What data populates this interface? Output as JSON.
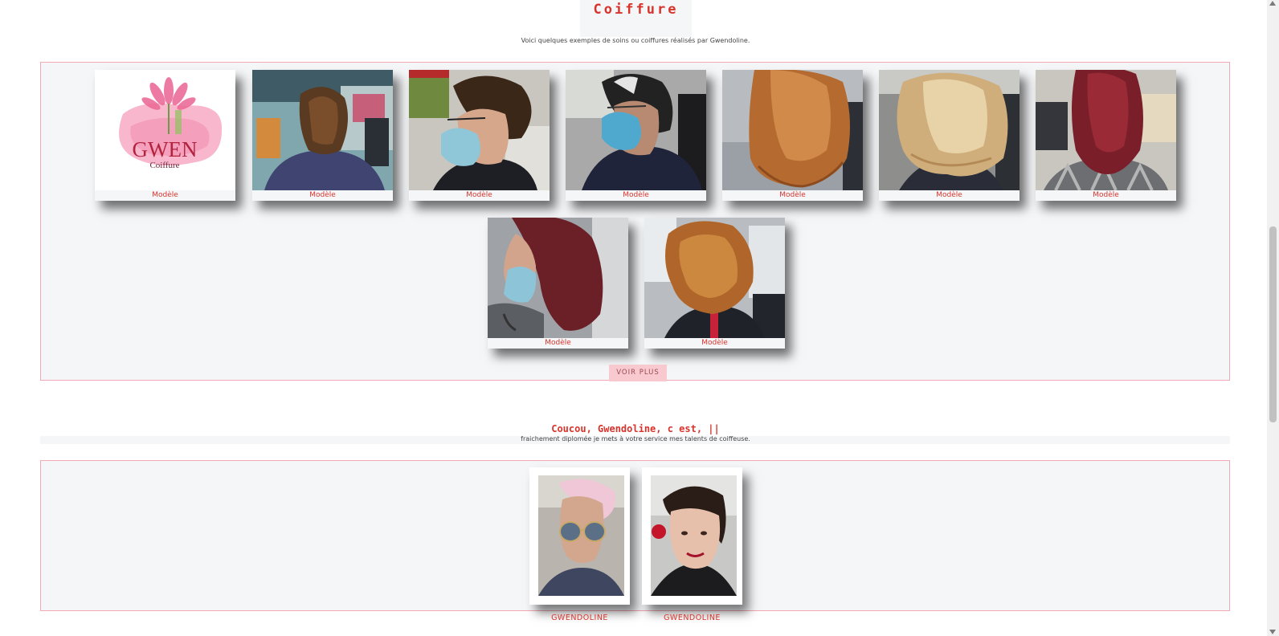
{
  "header": {
    "title": "Coiffure"
  },
  "gallery": {
    "intro": "Voici quelques exemples de soins ou coiffures réalisés par Gwendoline.",
    "logo": {
      "brand": "GWEN",
      "subtitle": "Coiffure"
    },
    "items": [
      {
        "caption": "Modèle"
      },
      {
        "caption": "Modèle"
      },
      {
        "caption": "Modèle"
      },
      {
        "caption": "Modèle"
      },
      {
        "caption": "Modèle"
      },
      {
        "caption": "Modèle"
      },
      {
        "caption": "Modèle"
      },
      {
        "caption": "Modèle"
      },
      {
        "caption": "Modèle"
      }
    ],
    "more_label": "VOIR PLUS"
  },
  "about": {
    "title": "Coucou, Gwendoline, c est, ||",
    "text": "fraichement diplomée je mets à votre service mes talents de coiffeuse."
  },
  "team": {
    "members": [
      {
        "name": "GWENDOLINE"
      },
      {
        "name": "GWENDOLINE"
      }
    ]
  },
  "colors": {
    "accent": "#d8342c",
    "frame_border": "#f4a8b4",
    "panel_bg": "#f5f6f8",
    "button_bg": "#f9c9d0"
  },
  "icons": {
    "scroll_up": "scroll-up-arrow-icon",
    "scroll_down": "scroll-down-arrow-icon"
  }
}
